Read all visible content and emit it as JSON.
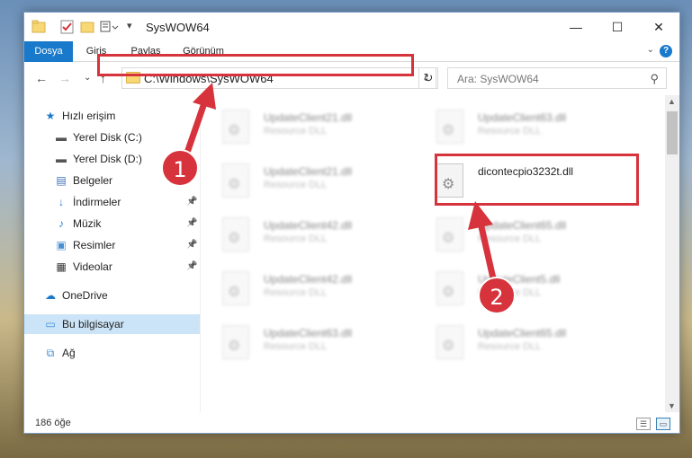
{
  "window": {
    "title": "SysWOW64",
    "controls": {
      "minimize": "—",
      "maximize": "☐",
      "close": "✕"
    }
  },
  "ribbon": {
    "tabs": [
      {
        "label": "Dosya",
        "active": true
      },
      {
        "label": "Giriş"
      },
      {
        "label": "Paylaş"
      },
      {
        "label": "Görünüm"
      }
    ],
    "help": "?"
  },
  "nav": {
    "address": "C:\\Windows\\SysWOW64",
    "search_placeholder": "Ara: SysWOW64"
  },
  "sidebar": {
    "items": [
      {
        "label": "Hızlı erişim",
        "icon": "star-icon",
        "glyph": "★",
        "color": "#1979ca",
        "indent": 0
      },
      {
        "label": "Yerel Disk (C:)",
        "icon": "drive-icon",
        "glyph": "▬",
        "color": "#555555",
        "indent": 1
      },
      {
        "label": "Yerel Disk (D:)",
        "icon": "drive-icon",
        "glyph": "▬",
        "color": "#555555",
        "indent": 1
      },
      {
        "label": "Belgeler",
        "icon": "documents-icon",
        "glyph": "▤",
        "color": "#3b6fb6",
        "indent": 1
      },
      {
        "label": "İndirmeler",
        "icon": "download-icon",
        "glyph": "↓",
        "color": "#1979ca",
        "indent": 1,
        "pinned": true
      },
      {
        "label": "Müzik",
        "icon": "music-icon",
        "glyph": "♪",
        "color": "#2a7ed2",
        "indent": 1,
        "pinned": true
      },
      {
        "label": "Resimler",
        "icon": "pictures-icon",
        "glyph": "▣",
        "color": "#4a8fd1",
        "indent": 1,
        "pinned": true
      },
      {
        "label": "Videolar",
        "icon": "video-icon",
        "glyph": "▦",
        "color": "#333333",
        "indent": 1,
        "pinned": true
      },
      {
        "label": "OneDrive",
        "icon": "cloud-icon",
        "glyph": "☁",
        "color": "#1979ca",
        "indent": 0
      },
      {
        "label": "Bu bilgisayar",
        "icon": "computer-icon",
        "glyph": "▭",
        "color": "#3b8ed6",
        "indent": 0,
        "selected": true
      },
      {
        "label": "Ağ",
        "icon": "network-icon",
        "glyph": "⧉",
        "color": "#3b8ed6",
        "indent": 0
      }
    ]
  },
  "files": [
    {
      "name": "UpdateClient21.dll",
      "type": "Resource DLL",
      "blurred": true
    },
    {
      "name": "UpdateClient63.dll",
      "type": "Resource DLL",
      "blurred": true
    },
    {
      "name": "UpdateClient21.dll",
      "type": "Resource DLL",
      "blurred": true
    },
    {
      "name": "dicontecpio3232t.dll",
      "type": "",
      "blurred": false
    },
    {
      "name": "UpdateClient42.dll",
      "type": "Resource DLL",
      "blurred": true
    },
    {
      "name": "UpdateClient65.dll",
      "type": "Resource DLL",
      "blurred": true
    },
    {
      "name": "UpdateClient42.dll",
      "type": "Resource DLL",
      "blurred": true
    },
    {
      "name": "UpdateClient5.dll",
      "type": "Resource DLL",
      "blurred": true
    },
    {
      "name": "UpdateClient63.dll",
      "type": "Resource DLL",
      "blurred": true
    },
    {
      "name": "UpdateClient65.dll",
      "type": "Resource DLL",
      "blurred": true
    }
  ],
  "status": {
    "count": "186 öğe"
  },
  "annotations": {
    "step1": "1",
    "step2": "2",
    "accent": "#d7333c"
  }
}
